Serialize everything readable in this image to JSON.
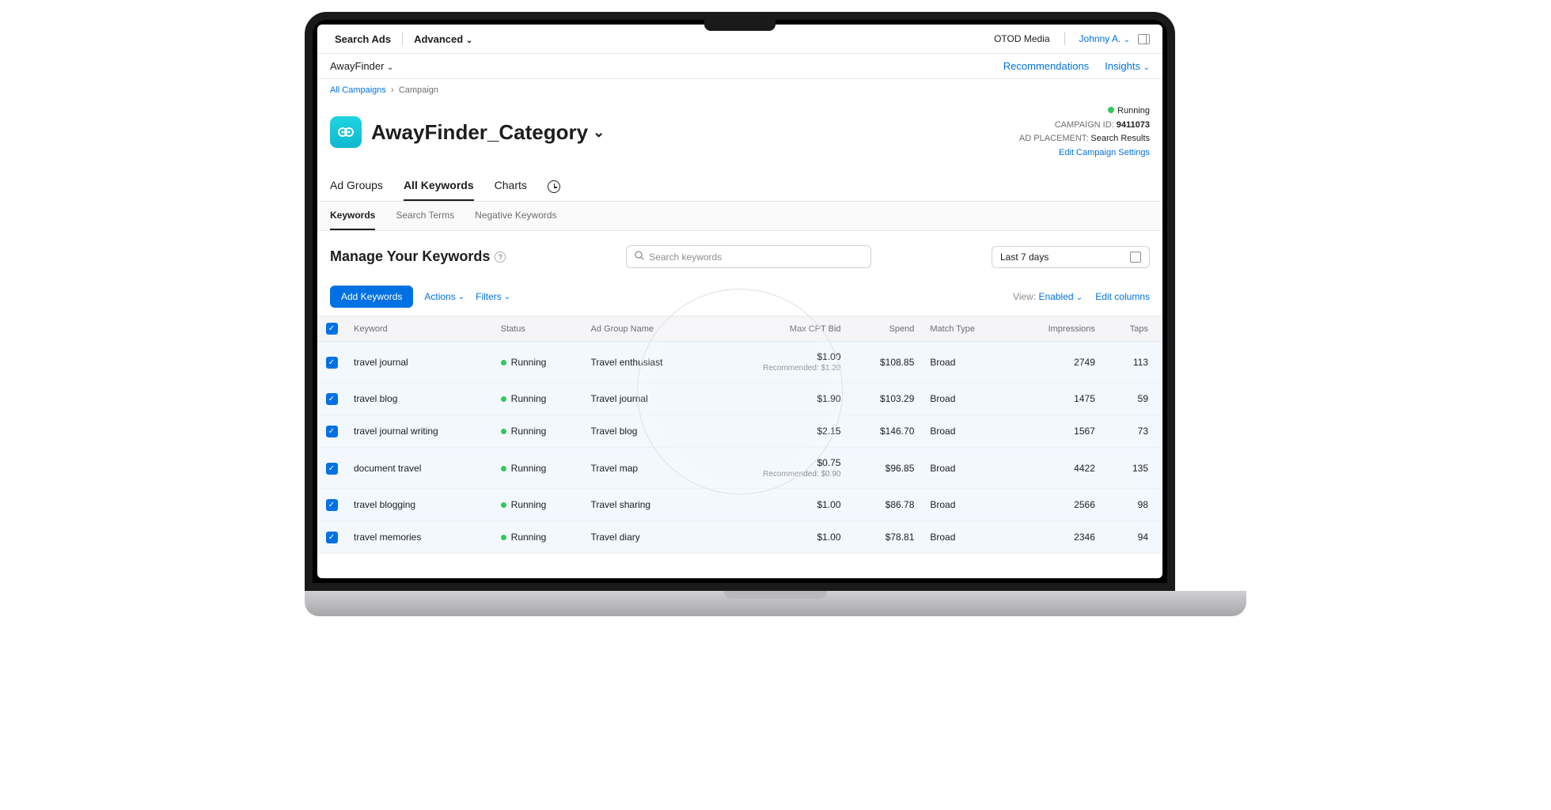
{
  "topbar": {
    "brand": "Search Ads",
    "mode": "Advanced",
    "org": "OTOD Media",
    "user": "Johnny A."
  },
  "subbar": {
    "app": "AwayFinder",
    "recommendations": "Recommendations",
    "insights": "Insights"
  },
  "breadcrumb": {
    "link": "All Campaigns",
    "current": "Campaign"
  },
  "campaign": {
    "title": "AwayFinder_Category",
    "status": "Running",
    "id_label": "CAMPAIGN ID:",
    "id": "9411073",
    "placement_label": "AD PLACEMENT:",
    "placement": "Search Results",
    "edit_link": "Edit Campaign Settings"
  },
  "main_tabs": [
    "Ad Groups",
    "All Keywords",
    "Charts"
  ],
  "sub_tabs": [
    "Keywords",
    "Search Terms",
    "Negative Keywords"
  ],
  "manage": {
    "title": "Manage Your Keywords",
    "search_placeholder": "Search keywords",
    "date_range": "Last 7 days"
  },
  "actions": {
    "add": "Add Keywords",
    "actions": "Actions",
    "filters": "Filters",
    "view_label": "View:",
    "view_value": "Enabled",
    "edit_cols": "Edit columns"
  },
  "columns": [
    "",
    "Keyword",
    "Status",
    "Ad Group Name",
    "Max CPT Bid",
    "Spend",
    "Match Type",
    "Impressions",
    "Taps"
  ],
  "rows": [
    {
      "keyword": "travel journal",
      "status": "Running",
      "group": "Travel enthusiast",
      "bid": "$1.00",
      "rec": "Recommended: $1.20",
      "spend": "$108.85",
      "match": "Broad",
      "impr": "2749",
      "taps": "113"
    },
    {
      "keyword": "travel blog",
      "status": "Running",
      "group": "Travel journal",
      "bid": "$1.90",
      "rec": "",
      "spend": "$103.29",
      "match": "Broad",
      "impr": "1475",
      "taps": "59"
    },
    {
      "keyword": "travel journal writing",
      "status": "Running",
      "group": "Travel blog",
      "bid": "$2.15",
      "rec": "",
      "spend": "$146.70",
      "match": "Broad",
      "impr": "1567",
      "taps": "73"
    },
    {
      "keyword": "document travel",
      "status": "Running",
      "group": "Travel map",
      "bid": "$0.75",
      "rec": "Recommended: $0.90",
      "spend": "$96.85",
      "match": "Broad",
      "impr": "4422",
      "taps": "135"
    },
    {
      "keyword": "travel blogging",
      "status": "Running",
      "group": "Travel sharing",
      "bid": "$1.00",
      "rec": "",
      "spend": "$86.78",
      "match": "Broad",
      "impr": "2566",
      "taps": "98"
    },
    {
      "keyword": "travel memories",
      "status": "Running",
      "group": "Travel diary",
      "bid": "$1.00",
      "rec": "",
      "spend": "$78.81",
      "match": "Broad",
      "impr": "2346",
      "taps": "94"
    }
  ]
}
